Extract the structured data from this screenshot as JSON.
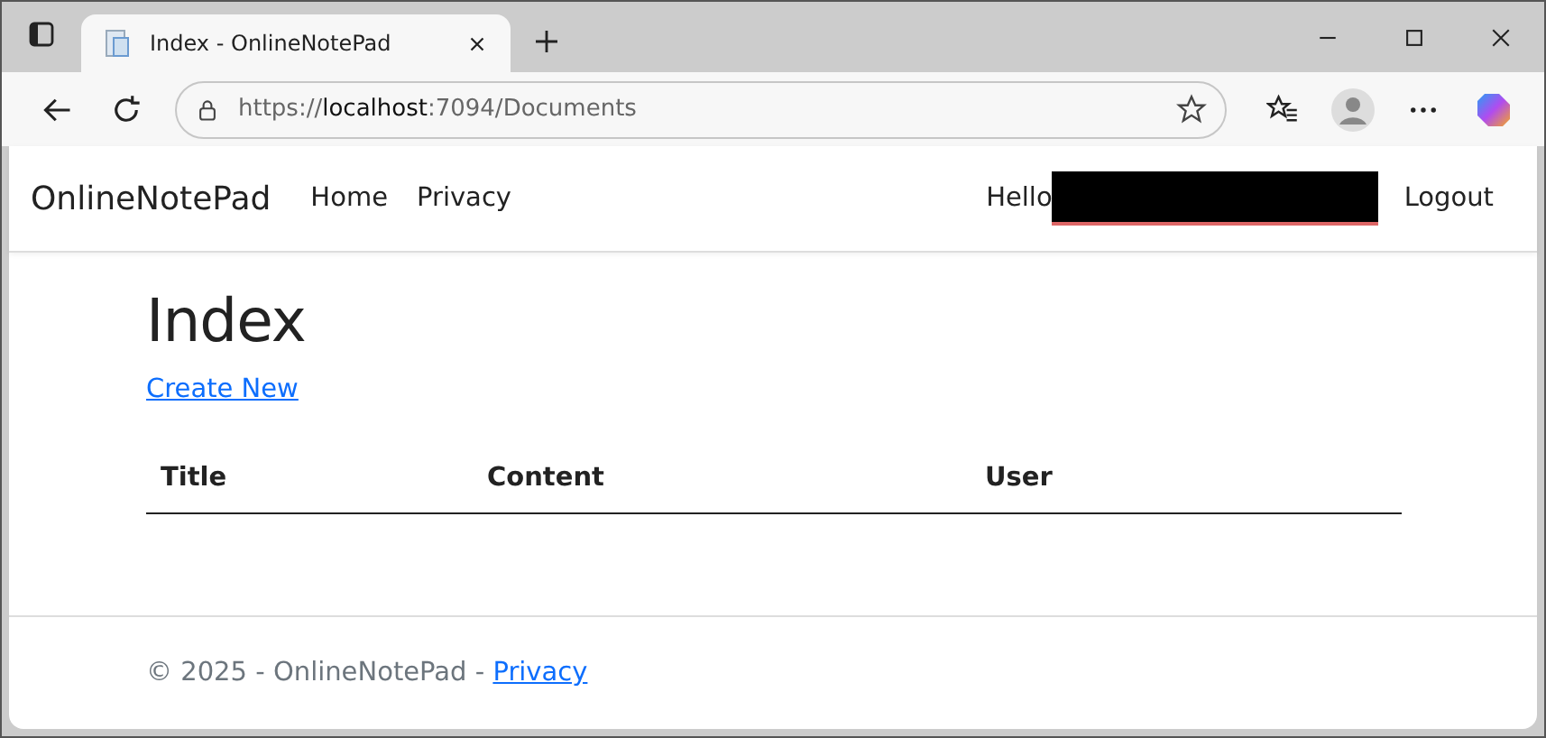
{
  "browser": {
    "tab": {
      "title": "Index - OnlineNotePad",
      "selected": true
    },
    "address": {
      "scheme": "https://",
      "host": "localhost",
      "rest": ":7094/Documents"
    }
  },
  "navbar": {
    "brand": "OnlineNotePad",
    "links": [
      "Home",
      "Privacy"
    ],
    "greeting": "Hello",
    "user_redacted": true,
    "logout": "Logout"
  },
  "page": {
    "heading": "Index",
    "create_link": "Create New",
    "table": {
      "columns": [
        "Title",
        "Content",
        "User"
      ]
    }
  },
  "footer": {
    "text": "© 2025 - OnlineNotePad -",
    "link": "Privacy"
  }
}
